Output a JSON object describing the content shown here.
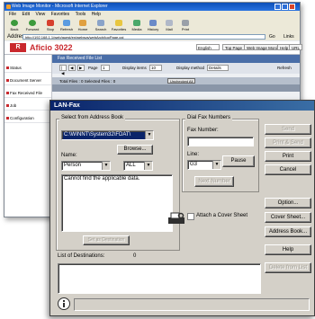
{
  "browser": {
    "title": "Web Image Monitor - Microsoft Internet Explorer",
    "menu": [
      "File",
      "Edit",
      "View",
      "Favorites",
      "Tools",
      "Help"
    ],
    "toolbar": [
      "Back",
      "Forward",
      "Stop",
      "Refresh",
      "Home",
      "Search",
      "Favorites",
      "Media",
      "History",
      "Mail",
      "Print"
    ],
    "address_label": "Address",
    "address_value": "http://192.168.1.1/web/guest/en/websys/webArch/topPage.cgi",
    "go_label": "Go",
    "links_label": "Links"
  },
  "app": {
    "logo": "R",
    "name": "Aficio 3022",
    "language": "English",
    "header_links": [
      "Top Page",
      "Web Image Monitor",
      "Help",
      "URL"
    ]
  },
  "nav": {
    "items": [
      "Status",
      "Document Server",
      "Fax Received File",
      "Job",
      "Configuration"
    ]
  },
  "pane": {
    "title": "Fax Received File List",
    "controls": [
      "Page",
      "Display items",
      "Display method"
    ],
    "page_value": "1",
    "display_items_value": "10",
    "display_method_value": "Details",
    "refresh_label": "Refresh",
    "table_summary": "Total Files : 0    Selected Files : 0",
    "table_button": "Unchecked All"
  },
  "dialog": {
    "title": "LAN-Fax",
    "address_book_group": "Select from Address Book",
    "address_path": "C:\\WINNT\\System32\\FDAT\\",
    "browse_label": "Browse...",
    "name_label": "Name:",
    "name_type": "Person",
    "name_filter": "ALL",
    "address_book_message": "Cannot find the applicable data.",
    "set_destination_label": "Set as Destination",
    "dial_group": "Dial Fax Numbers",
    "fax_number_label": "Fax Number:",
    "fax_number_value": "",
    "line_label": "Line:",
    "line_value": "G3",
    "pause_label": "Pause",
    "next_number_label": "Next Number",
    "attach_cover_label": "Attach a Cover Sheet",
    "attach_cover_checked": false,
    "destinations_label": "List of Destinations:",
    "destinations_count": "0",
    "right_buttons": {
      "send": "Send",
      "print_send": "Print & Send",
      "print": "Print",
      "cancel": "Cancel",
      "option": "Option...",
      "cover_sheet": "Cover Sheet...",
      "address_book": "Address Book...",
      "help": "Help",
      "delete_from_list": "Delete from List"
    }
  },
  "colors": {
    "dialog_bg": "#d4d0c8",
    "title_gradient_start": "#0a246a",
    "title_gradient_end": "#3a6ea5",
    "brand_red": "#c9282d",
    "path_selection": "#0a246a"
  }
}
